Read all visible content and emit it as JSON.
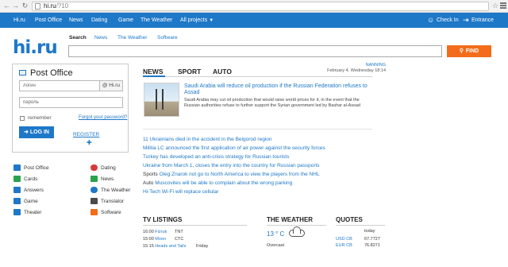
{
  "browser": {
    "url_host": "hi.ru",
    "url_path": "/?10"
  },
  "topnav": {
    "items": [
      "Hi.ru",
      "Post Office",
      "News",
      "Dating",
      "Game",
      "The Weather",
      "All projects"
    ],
    "check_in": "Check In",
    "entrance": "Entrance"
  },
  "logo": "hi.ru",
  "search": {
    "tabs": [
      "Search",
      "News",
      "The Weather",
      "Software"
    ],
    "value": "",
    "button": "FIND"
  },
  "login": {
    "title": "Post Office",
    "login_placeholder": "логин",
    "domain_suffix": "@ Hi.ru",
    "password_placeholder": "пароль",
    "remember": "remember",
    "forgot": "Forgot your password?",
    "login_button": "LOG IN",
    "register": "REGISTER"
  },
  "services": [
    {
      "label": "Post Office",
      "icon": "envelope-icon",
      "color": "#1e78c8"
    },
    {
      "label": "Dating",
      "icon": "heart-icon",
      "color": "#d83a3a"
    },
    {
      "label": "Cards",
      "icon": "cards-icon",
      "color": "#2aa34a"
    },
    {
      "label": "News",
      "icon": "news-icon",
      "color": "#2aa34a"
    },
    {
      "label": "Answers",
      "icon": "answers-icon",
      "color": "#1e78c8"
    },
    {
      "label": "The Weather",
      "icon": "weather-icon",
      "color": "#1e78c8"
    },
    {
      "label": "Game",
      "icon": "game-icon",
      "color": "#1e78c8"
    },
    {
      "label": "Translator",
      "icon": "translator-icon",
      "color": "#4a4a4a"
    },
    {
      "label": "Theater",
      "icon": "theater-icon",
      "color": "#1e78c8"
    },
    {
      "label": "Software",
      "icon": "software-icon",
      "color": "#f26c1b"
    }
  ],
  "news": {
    "tabs": [
      "NEWS",
      "SPORT",
      "AUTO"
    ],
    "weather_city": "NANNING",
    "date": "February 4, Wednesday 18:14",
    "main_headline": "Saudi Arabia will reduce oil production if the Russian Federation refuses to Assad",
    "main_body": "Saudi Arabia may cut oil production that would raise world prices for it, in the event that the Russian authorities refuse to further support the Syrian government led by Bashar al-Assad",
    "items": [
      {
        "prefix": "",
        "text": "11 Ukrainians died in the accident in the Belgorod region"
      },
      {
        "prefix": "",
        "text": "Militia LC announced the first application of air power against the security forces"
      },
      {
        "prefix": "",
        "text": "Turkey has developed an anti-crisis strategy for Russian tourists"
      },
      {
        "prefix": "",
        "text": "Ukraine from March 1, closes the entry into the country for Russian passports"
      },
      {
        "prefix": "Sports",
        "text": "Oleg Znarok not go to North America to view the players from the NHL"
      },
      {
        "prefix": "Auto",
        "text": "Muscovites will be able to complain about the wrong parking"
      },
      {
        "prefix": "Hi-Tech",
        "text": "Wi-Fi will replace cellular"
      }
    ]
  },
  "tv": {
    "title": "TV LISTINGS",
    "rows": [
      {
        "time": "16:00",
        "show": "Fizruk",
        "channel": "TNT"
      },
      {
        "time": "15:00",
        "show": "Moon",
        "channel": "CTC"
      },
      {
        "time": "15:15",
        "show": "Heads and Tails",
        "channel": "Friday"
      }
    ]
  },
  "weather": {
    "title": "THE WEATHER",
    "temp": "13 ° C",
    "condition": "Overcast"
  },
  "quotes": {
    "title": "QUOTES",
    "header": "today",
    "rows": [
      {
        "label": "USD CB",
        "value": "67.7727"
      },
      {
        "label": "EUR CB",
        "value": "76.8271"
      }
    ]
  }
}
